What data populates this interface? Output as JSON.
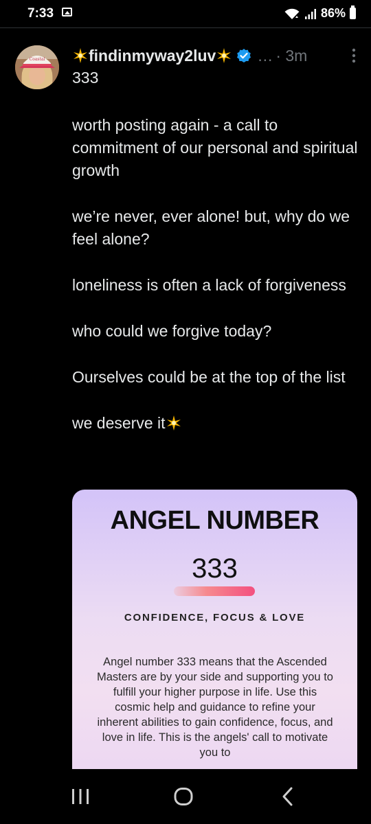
{
  "status_bar": {
    "time": "7:33",
    "battery_percent": "86%",
    "icons": [
      "gallery-icon",
      "wifi-icon",
      "signal-icon",
      "battery-icon"
    ]
  },
  "post": {
    "author_name": "findinmyway2luv",
    "name_emoji": "sparkle",
    "verified": true,
    "ellipsis": "…",
    "time": "· 3m",
    "paragraphs": [
      "333",
      "worth posting again - a call to commitment of our personal and spiritual growth",
      "we’re never, ever alone! but, why do we feel alone?",
      "loneliness is often a lack of forgiveness",
      "who could we forgive today?",
      "Ourselves could be at the top of the list",
      "we deserve it"
    ]
  },
  "image_card": {
    "title": "ANGEL NUMBER",
    "number": "333",
    "subtitle": "CONFIDENCE, FOCUS & LOVE",
    "text": "Angel number 333 means that the Ascended Masters are by your side and supporting you to fulfill your higher purpose in life. Use this cosmic help and guidance to refine your inherent abilities to gain confidence, focus, and love in life. This is the angels' call to motivate you to"
  },
  "colors": {
    "background": "#000000",
    "text": "#e7e9ea",
    "muted": "#71767b",
    "verified": "#1d9bf0",
    "sparkle": "#f5b400"
  }
}
